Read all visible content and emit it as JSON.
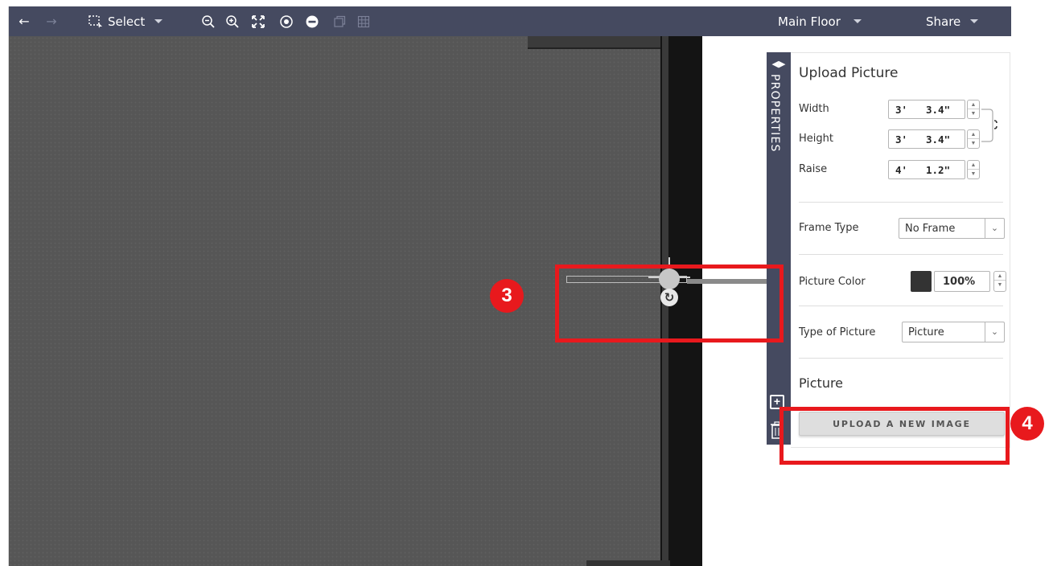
{
  "toolbar": {
    "back_icon": "arrow-left-icon",
    "forward_icon": "arrow-right-icon",
    "select_label": "Select",
    "floor_label": "Main Floor",
    "share_label": "Share"
  },
  "sidebar": {
    "label": "PROPERTIES"
  },
  "panel": {
    "title": "Upload Picture",
    "width": {
      "label": "Width",
      "feet": "3'",
      "inches": "3.4\""
    },
    "height": {
      "label": "Height",
      "feet": "3'",
      "inches": "3.4\""
    },
    "raise": {
      "label": "Raise",
      "feet": "4'",
      "inches": "1.2\""
    },
    "frame_type": {
      "label": "Frame Type",
      "value": "No Frame"
    },
    "picture_color": {
      "label": "Picture Color",
      "swatch": "#333333",
      "opacity": "100%"
    },
    "type_of_picture": {
      "label": "Type of Picture",
      "value": "Picture"
    },
    "picture_section": {
      "title": "Picture",
      "upload_label": "UPLOAD A NEW IMAGE"
    }
  },
  "annotations": {
    "marker_3": "3",
    "marker_4": "4",
    "color": "#e8191d"
  }
}
